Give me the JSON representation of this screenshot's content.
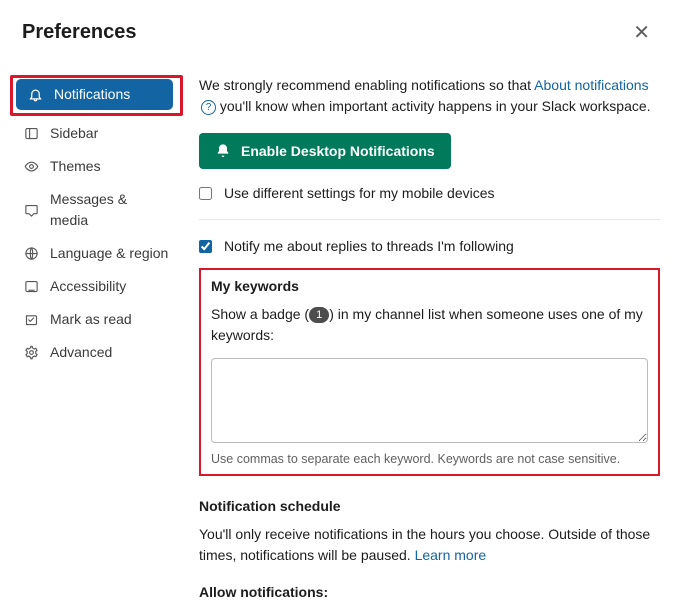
{
  "header": {
    "title": "Preferences"
  },
  "sidebar": {
    "items": [
      {
        "label": "Notifications",
        "active": true
      },
      {
        "label": "Sidebar"
      },
      {
        "label": "Themes"
      },
      {
        "label": "Messages & media"
      },
      {
        "label": "Language & region"
      },
      {
        "label": "Accessibility"
      },
      {
        "label": "Mark as read"
      },
      {
        "label": "Advanced"
      }
    ]
  },
  "notifications": {
    "recommend_pre": "We strongly recommend enabling notifications so that ",
    "about_link": "About notifications",
    "recommend_post": " you'll know when important activity happens in your Slack workspace.",
    "enable_btn": "Enable Desktop Notifications",
    "mobile_checkbox_label": "Use different settings for my mobile devices",
    "thread_checkbox_label": "Notify me about replies to threads I'm following",
    "keywords": {
      "title": "My keywords",
      "desc_pre": "Show a badge (",
      "badge": "1",
      "desc_post": ") in my channel list when someone uses one of my keywords:",
      "value": "",
      "hint": "Use commas to separate each keyword. Keywords are not case sensitive."
    },
    "schedule": {
      "title": "Notification schedule",
      "desc": "You'll only receive notifications in the hours you choose. Outside of those times, notifications will be paused. ",
      "learn_more": "Learn more"
    },
    "cutoff_heading": "Allow notifications:"
  }
}
